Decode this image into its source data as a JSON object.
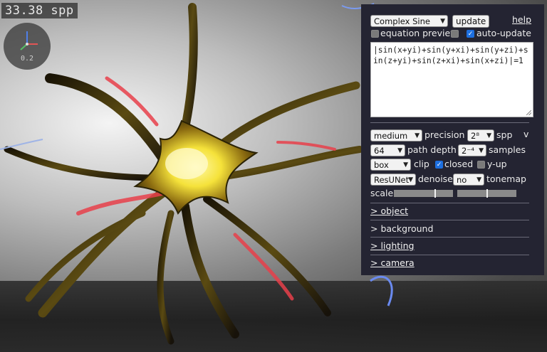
{
  "spp_readout": "33.38 spp",
  "gizmo": {
    "value": "0.2"
  },
  "panel": {
    "preset_select": "Complex Sine",
    "update_button": "update",
    "help_link": "help",
    "equation_preview_label": "equation preview",
    "equation_preview_checked": false,
    "extra_checkbox_checked": false,
    "auto_update_label": "auto-update",
    "auto_update_checked": true,
    "equation": "|sin(x+yi)+sin(y+xi)+sin(y+zi)+sin(z+yi)+sin(z+xi)+sin(x+zi)|=1",
    "precision_select": "medium",
    "precision_label": "precision",
    "spp_select": "2⁸",
    "spp_label": "spp",
    "collapse_toggle": "v",
    "path_depth_select": "64",
    "path_depth_label": "path depth",
    "samples_select": "2⁻⁴",
    "samples_label": "samples",
    "clip_select": "box",
    "clip_label": "clip",
    "closed_label": "closed",
    "closed_checked": true,
    "yup_label": "y-up",
    "yup_checked": false,
    "denoise_select": "ResUNet",
    "denoise_label": "denoise",
    "tonemap_select": "no",
    "tonemap_label": "tonemap",
    "scale_label": "scale",
    "scale_slider_1": 0.7,
    "scale_slider_2": 0.5,
    "sections": [
      "> object",
      "> background",
      "> lighting",
      "> camera"
    ]
  },
  "colors": {
    "panel_bg": "#242432",
    "checkbox_accent": "#1d6fe0",
    "surface_yellow": "#f5e23a",
    "surface_red": "#e8404a"
  }
}
